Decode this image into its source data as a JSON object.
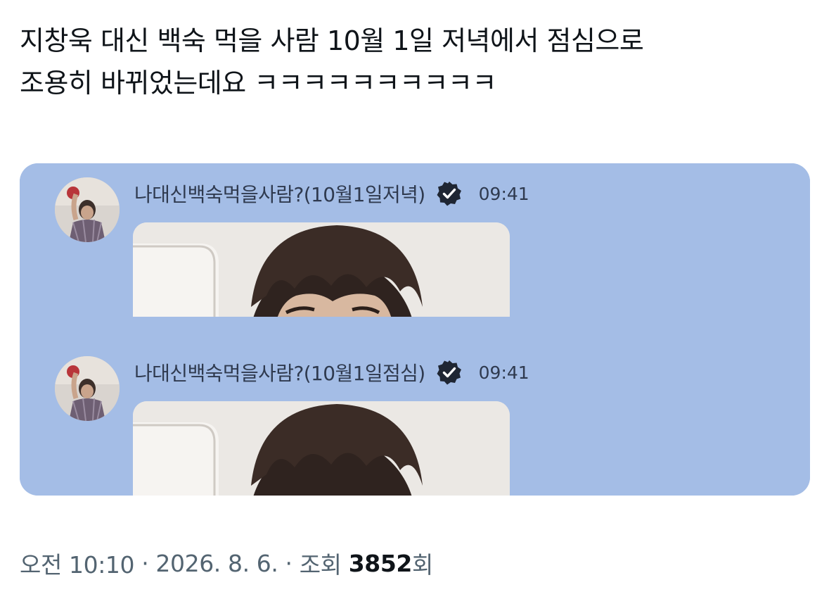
{
  "tweet": {
    "text": "지창욱 대신 백숙 먹을 사람 10월 1일 저녁에서 점심으로\n조용히 바뀌었는데요 ㅋㅋㅋㅋㅋㅋㅋㅋㅋㅋ"
  },
  "media": {
    "panels": [
      {
        "sender": "나대신백숙먹을사람?(10월1일저녁)",
        "time": "09:41",
        "verified_icon": "verified-badge-icon"
      },
      {
        "sender": "나대신백숙먹을사람?(10월1일점심)",
        "time": "09:41",
        "verified_icon": "verified-badge-icon"
      }
    ],
    "background_color": "#a4bde6"
  },
  "meta": {
    "time": "오전 10:10",
    "sep1": " · ",
    "date": "2026. 8. 6.",
    "sep2": " · ",
    "views_label": "조회 ",
    "views_count": "3852",
    "views_suffix": "회"
  }
}
